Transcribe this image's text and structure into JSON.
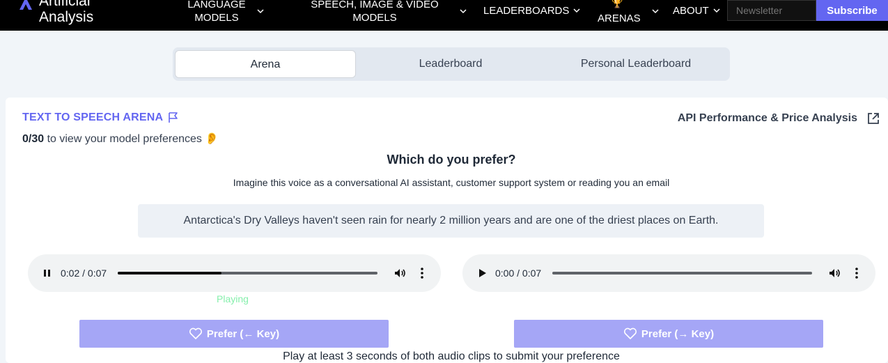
{
  "nav": {
    "brand": "Artificial Analysis",
    "items": [
      {
        "label": "LANGUAGE MODELS"
      },
      {
        "label": "SPEECH, IMAGE & VIDEO MODELS"
      },
      {
        "label": "LEADERBOARDS"
      },
      {
        "label": "ARENAS"
      },
      {
        "label": "ABOUT"
      }
    ],
    "newsletter_placeholder": "Newsletter",
    "subscribe_label": "Subscribe"
  },
  "tabs": [
    "Arena",
    "Leaderboard",
    "Personal Leaderboard"
  ],
  "arena": {
    "title": "TEXT TO SPEECH ARENA",
    "progress_count": "0/30",
    "progress_text": " to view your model preferences ",
    "api_link": "API Performance & Price Analysis",
    "question": "Which do you prefer?",
    "instruction": "Imagine this voice as a conversational AI assistant, customer support system or reading you an email",
    "sentence": "Antarctica's Dry Valleys haven't seen rain for nearly 2 million years and are one of the driest places on Earth.",
    "player_a": {
      "time": "0:02 / 0:07",
      "progress": 0.4,
      "state": "pause-icon"
    },
    "player_b": {
      "time": "0:00 / 0:07",
      "progress": 0.0,
      "state": "play-icon"
    },
    "status": "Playing",
    "prefer_left": "Prefer  (← Key)",
    "prefer_right": "Prefer  (→ Key)",
    "hint": "Play at least 3 seconds of both audio clips to submit your preference"
  },
  "colors": {
    "accent": "#6366f1",
    "prefer_button": "#a5a6f6",
    "playing": "#86efac"
  }
}
